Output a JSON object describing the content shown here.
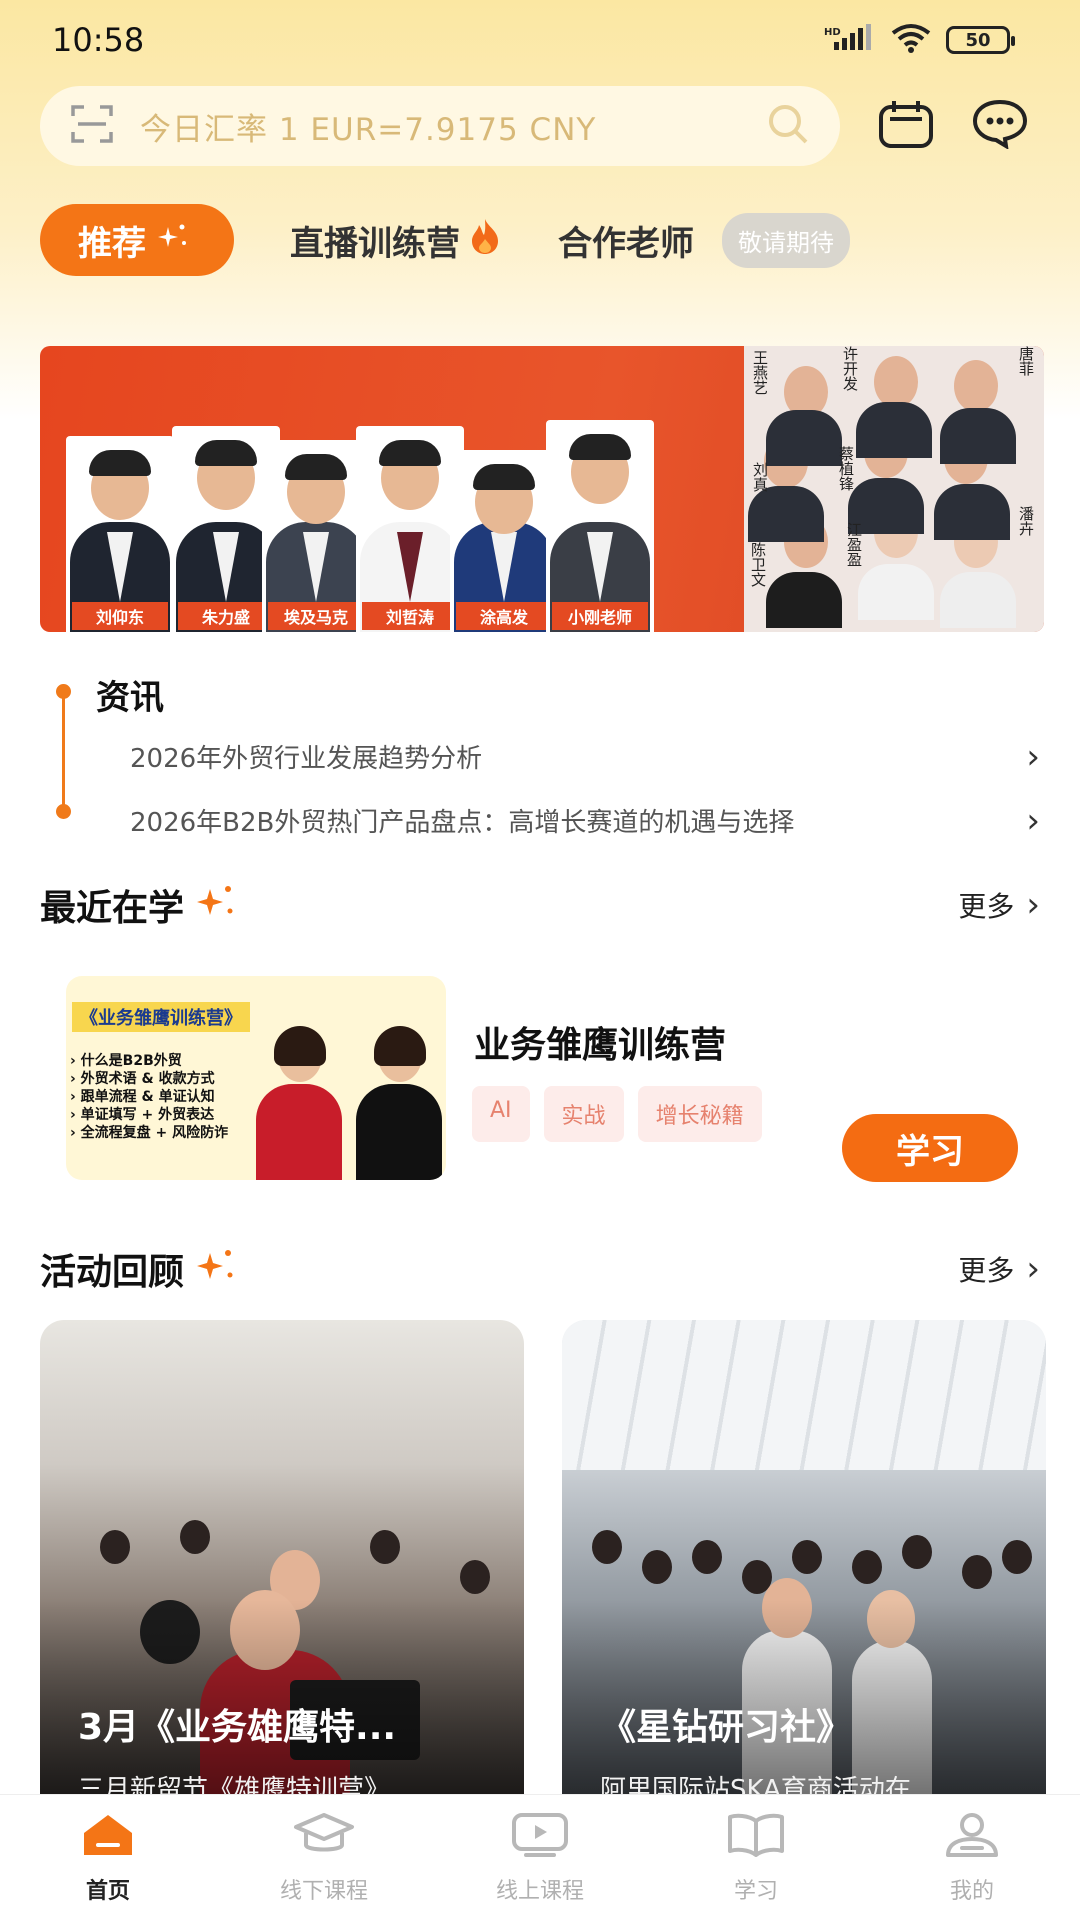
{
  "status": {
    "time": "10:58",
    "battery": "50",
    "network": "HD"
  },
  "search": {
    "text": "今日汇率 1 EUR=7.9175 CNY"
  },
  "tabs": {
    "active": "推荐",
    "items": [
      "直播训练营",
      "合作老师"
    ],
    "badge": "敬请期待"
  },
  "banner": {
    "teachers": [
      "刘仰东",
      "朱力盛",
      "埃及马克",
      "刘哲涛",
      "涂高发",
      "小刚老师"
    ],
    "right_names": [
      "王燕艺",
      "许开发",
      "唐菲",
      "刘真",
      "蔡植锋",
      "江盈盈",
      "陈卫文",
      "潘卉"
    ]
  },
  "news": {
    "title": "资讯",
    "items": [
      "2026年外贸行业发展趋势分析",
      "2026年B2B外贸热门产品盘点：高增长赛道的机遇与选择"
    ]
  },
  "recent": {
    "title": "最近在学",
    "more": "更多",
    "course": {
      "thumb_title": "《业务雏鹰训练营》",
      "bullets": [
        "什么是B2B外贸",
        "外贸术语 & 收款方式",
        "跟单流程 & 单证认知",
        "单证填写 + 外贸表达",
        "全流程复盘 + 风险防诈"
      ],
      "name": "业务雏鹰训练营",
      "tags": [
        "AI",
        "实战",
        "增长秘籍"
      ],
      "button": "学习"
    }
  },
  "activities": {
    "title": "活动回顾",
    "more": "更多",
    "items": [
      {
        "title": "3月《业务雄鹰特...",
        "subtitle": "三月新留节《雄鹰特训营》..."
      },
      {
        "title": "《星钻研习社》",
        "subtitle": "阿里国际站SKA育商活动在..."
      }
    ]
  },
  "nav": [
    "首页",
    "线下课程",
    "线上课程",
    "学习",
    "我的"
  ],
  "colors": {
    "accent": "#f47516",
    "header_bg": "#fbe7a2"
  }
}
